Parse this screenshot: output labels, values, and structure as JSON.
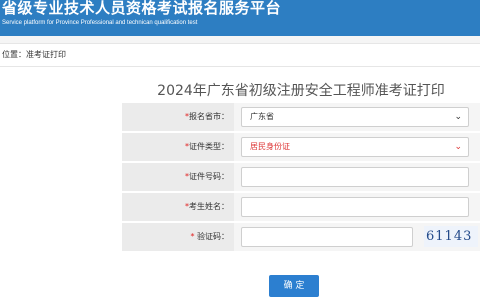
{
  "header": {
    "title": "省级专业技术人员资格考试报名服务平台",
    "subtitle": "Service platform for Province Professional and technican qualification test"
  },
  "breadcrumb": "位置：准考证打印",
  "form": {
    "title": "2024年广东省初级注册安全工程师准考证打印",
    "province_label": "报名省市：",
    "province_value": "广东省",
    "id_type_label": "证件类型：",
    "id_type_value": "居民身份证",
    "id_number_label": "证件号码：",
    "name_label": "考生姓名：",
    "captcha_label": "验证码：",
    "captcha_text": "61143",
    "required_mark": "*",
    "submit_label": "确 定"
  }
}
